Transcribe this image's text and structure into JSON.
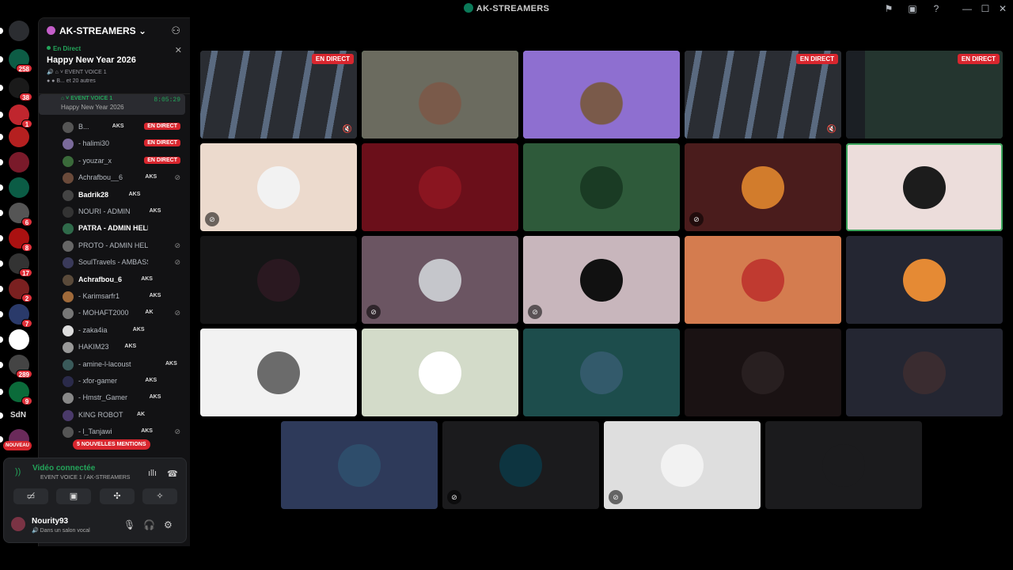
{
  "window": {
    "title": "AK-STREAMERS",
    "icons": [
      "inbox-icon",
      "screen-icon",
      "help-icon",
      "minimize-icon",
      "maximize-icon",
      "close-icon"
    ]
  },
  "rail": {
    "servers": [
      {
        "name": "discord-home",
        "badge": ""
      },
      {
        "name": "server-1",
        "badge": "258"
      },
      {
        "name": "server-2",
        "badge": "38"
      },
      {
        "name": "server-3",
        "badge": "1"
      },
      {
        "name": "server-4",
        "badge": ""
      },
      {
        "name": "server-5",
        "badge": ""
      },
      {
        "name": "server-6",
        "badge": ""
      },
      {
        "name": "server-7",
        "badge": "6"
      },
      {
        "name": "server-8",
        "badge": "8"
      },
      {
        "name": "server-9",
        "badge": "17"
      },
      {
        "name": "server-10",
        "badge": "2"
      },
      {
        "name": "server-11",
        "badge": "7"
      },
      {
        "name": "server-12",
        "badge": ""
      },
      {
        "name": "server-13",
        "badge": "289"
      },
      {
        "name": "server-14",
        "badge": "9"
      },
      {
        "name": "server-sdn",
        "badge": "",
        "label": "SdN"
      },
      {
        "name": "server-15",
        "badge": ""
      }
    ],
    "new_label": "NOUVEAU"
  },
  "sidebar": {
    "guild_name": "AK-STREAMERS",
    "event": {
      "live_label": "En Direct",
      "title": "Happy New Year 2026",
      "channel": "EVENT VOICE 1",
      "attendees": "B... et 20 autres"
    },
    "voice_channel": {
      "name": "EVENT VOICE 1",
      "timer": "8:05:29",
      "subtitle": "Happy New Year 2026"
    },
    "members": [
      {
        "name": "B...",
        "tag": "AKS",
        "live": true
      },
      {
        "name": "- halimi30",
        "tag": "",
        "live": true
      },
      {
        "name": "- youzar_x",
        "tag": "",
        "live": true
      },
      {
        "name": "Achrafbou__6",
        "tag": "AKS",
        "live": false,
        "muted": true
      },
      {
        "name": "Badrik28",
        "tag": "AKS",
        "live": false
      },
      {
        "name": "NOURI - ADMIN",
        "tag": "AKS",
        "live": false
      },
      {
        "name": "PATRA - ADMIN HELPER",
        "tag": "",
        "live": false
      },
      {
        "name": "PROTO - ADMIN HELPER",
        "tag": "",
        "live": false,
        "muted": true
      },
      {
        "name": "SoulTravels - AMBASSAD...",
        "tag": "",
        "live": false,
        "muted": true
      },
      {
        "name": "Achrafbou_6",
        "tag": "AKS",
        "live": false
      },
      {
        "name": "- Karimsarfr1",
        "tag": "AKS",
        "live": false
      },
      {
        "name": "- MOHAFT2000",
        "tag": "AK",
        "live": false,
        "muted": true
      },
      {
        "name": "- zaka4ia",
        "tag": "AKS",
        "live": false
      },
      {
        "name": "HAKIM23",
        "tag": "AKS",
        "live": false
      },
      {
        "name": "- amine-l-lacoust",
        "tag": "AKS",
        "live": false
      },
      {
        "name": "- xfor-gamer",
        "tag": "AKS",
        "live": false
      },
      {
        "name": "- Hmstr_Gamer",
        "tag": "AKS",
        "live": false
      },
      {
        "name": "KING ROBOT",
        "tag": "AK",
        "live": false
      },
      {
        "name": "- l_Tanjawi",
        "tag": "AKS",
        "live": false,
        "muted": true
      }
    ],
    "live_label": "EN DIRECT",
    "mentions_label": "5 NOUVELLES MENTIONS"
  },
  "voice_panel": {
    "status": "Vidéo connectée",
    "location": "EVENT VOICE 1 / AK-STREAMERS",
    "buttons": [
      "camera-off-icon",
      "screen-share-icon",
      "activities-icon",
      "soundboard-icon"
    ]
  },
  "user": {
    "name": "Nourity93",
    "status": "Dans un salon vocal"
  },
  "tiles": {
    "live_label": "EN DIRECT",
    "rows": [
      [
        {
          "kind": "game",
          "live": true,
          "color": "#3a3a3a"
        },
        {
          "kind": "cam",
          "live": false,
          "color": "#6b6b5f",
          "speaking": true
        },
        {
          "kind": "cam",
          "live": false,
          "color": "#8e6fd0"
        },
        {
          "kind": "game",
          "live": true,
          "color": "#4a4f56"
        },
        {
          "kind": "desktop",
          "live": true,
          "color": "#2c3b36"
        }
      ],
      [
        {
          "kind": "avatar",
          "color": "#ecdacd",
          "muted": true,
          "avatar": "#f2f2f2"
        },
        {
          "kind": "avatar",
          "color": "#6b0f1a",
          "avatar": "#8a1520"
        },
        {
          "kind": "avatar",
          "color": "#2e5a3a",
          "avatar": "#1a3b24"
        },
        {
          "kind": "avatar",
          "color": "#4a1c1c",
          "muted": true,
          "avatar": "#d27c2c"
        },
        {
          "kind": "avatar",
          "color": "#ecdddb",
          "avatar": "#1c1c1c",
          "speaking": true
        }
      ],
      [
        {
          "kind": "avatar",
          "color": "#151516",
          "avatar": "#2a1820"
        },
        {
          "kind": "avatar",
          "color": "#6b5562",
          "muted": true,
          "avatar": "#c5c6cb"
        },
        {
          "kind": "avatar",
          "color": "#c8b6bc",
          "muted": true,
          "avatar": "#111"
        },
        {
          "kind": "avatar",
          "color": "#d47c4f",
          "avatar": "#c03a30"
        },
        {
          "kind": "avatar",
          "color": "#242632",
          "avatar": "#e58a34"
        }
      ],
      [
        {
          "kind": "avatar",
          "color": "#f2f2f2",
          "avatar": "#6b6b6b"
        },
        {
          "kind": "avatar",
          "color": "#d3dbc9",
          "avatar": "#ffffff"
        },
        {
          "kind": "avatar",
          "color": "#1d4d4c",
          "avatar": "#335a6b"
        },
        {
          "kind": "avatar",
          "color": "#1a1213",
          "avatar": "#281f20"
        },
        {
          "kind": "avatar",
          "color": "#242632",
          "avatar": "#3a2c30"
        }
      ],
      [
        {
          "kind": "avatar",
          "color": "#2e3a5a",
          "avatar": "#2e4d6b"
        },
        {
          "kind": "avatar",
          "color": "#1b1b1d",
          "muted": true,
          "avatar": "#0d3440"
        },
        {
          "kind": "avatar",
          "color": "#dedede",
          "muted": true,
          "avatar": "#f2f2f2"
        },
        {
          "kind": "avatar",
          "color": "#1b1b1d",
          "avatar": "#1b1b1d"
        }
      ]
    ]
  },
  "colors": {
    "live": "#d8262e",
    "connected": "#23a55a",
    "speaking_outline": "#3ba55c"
  }
}
